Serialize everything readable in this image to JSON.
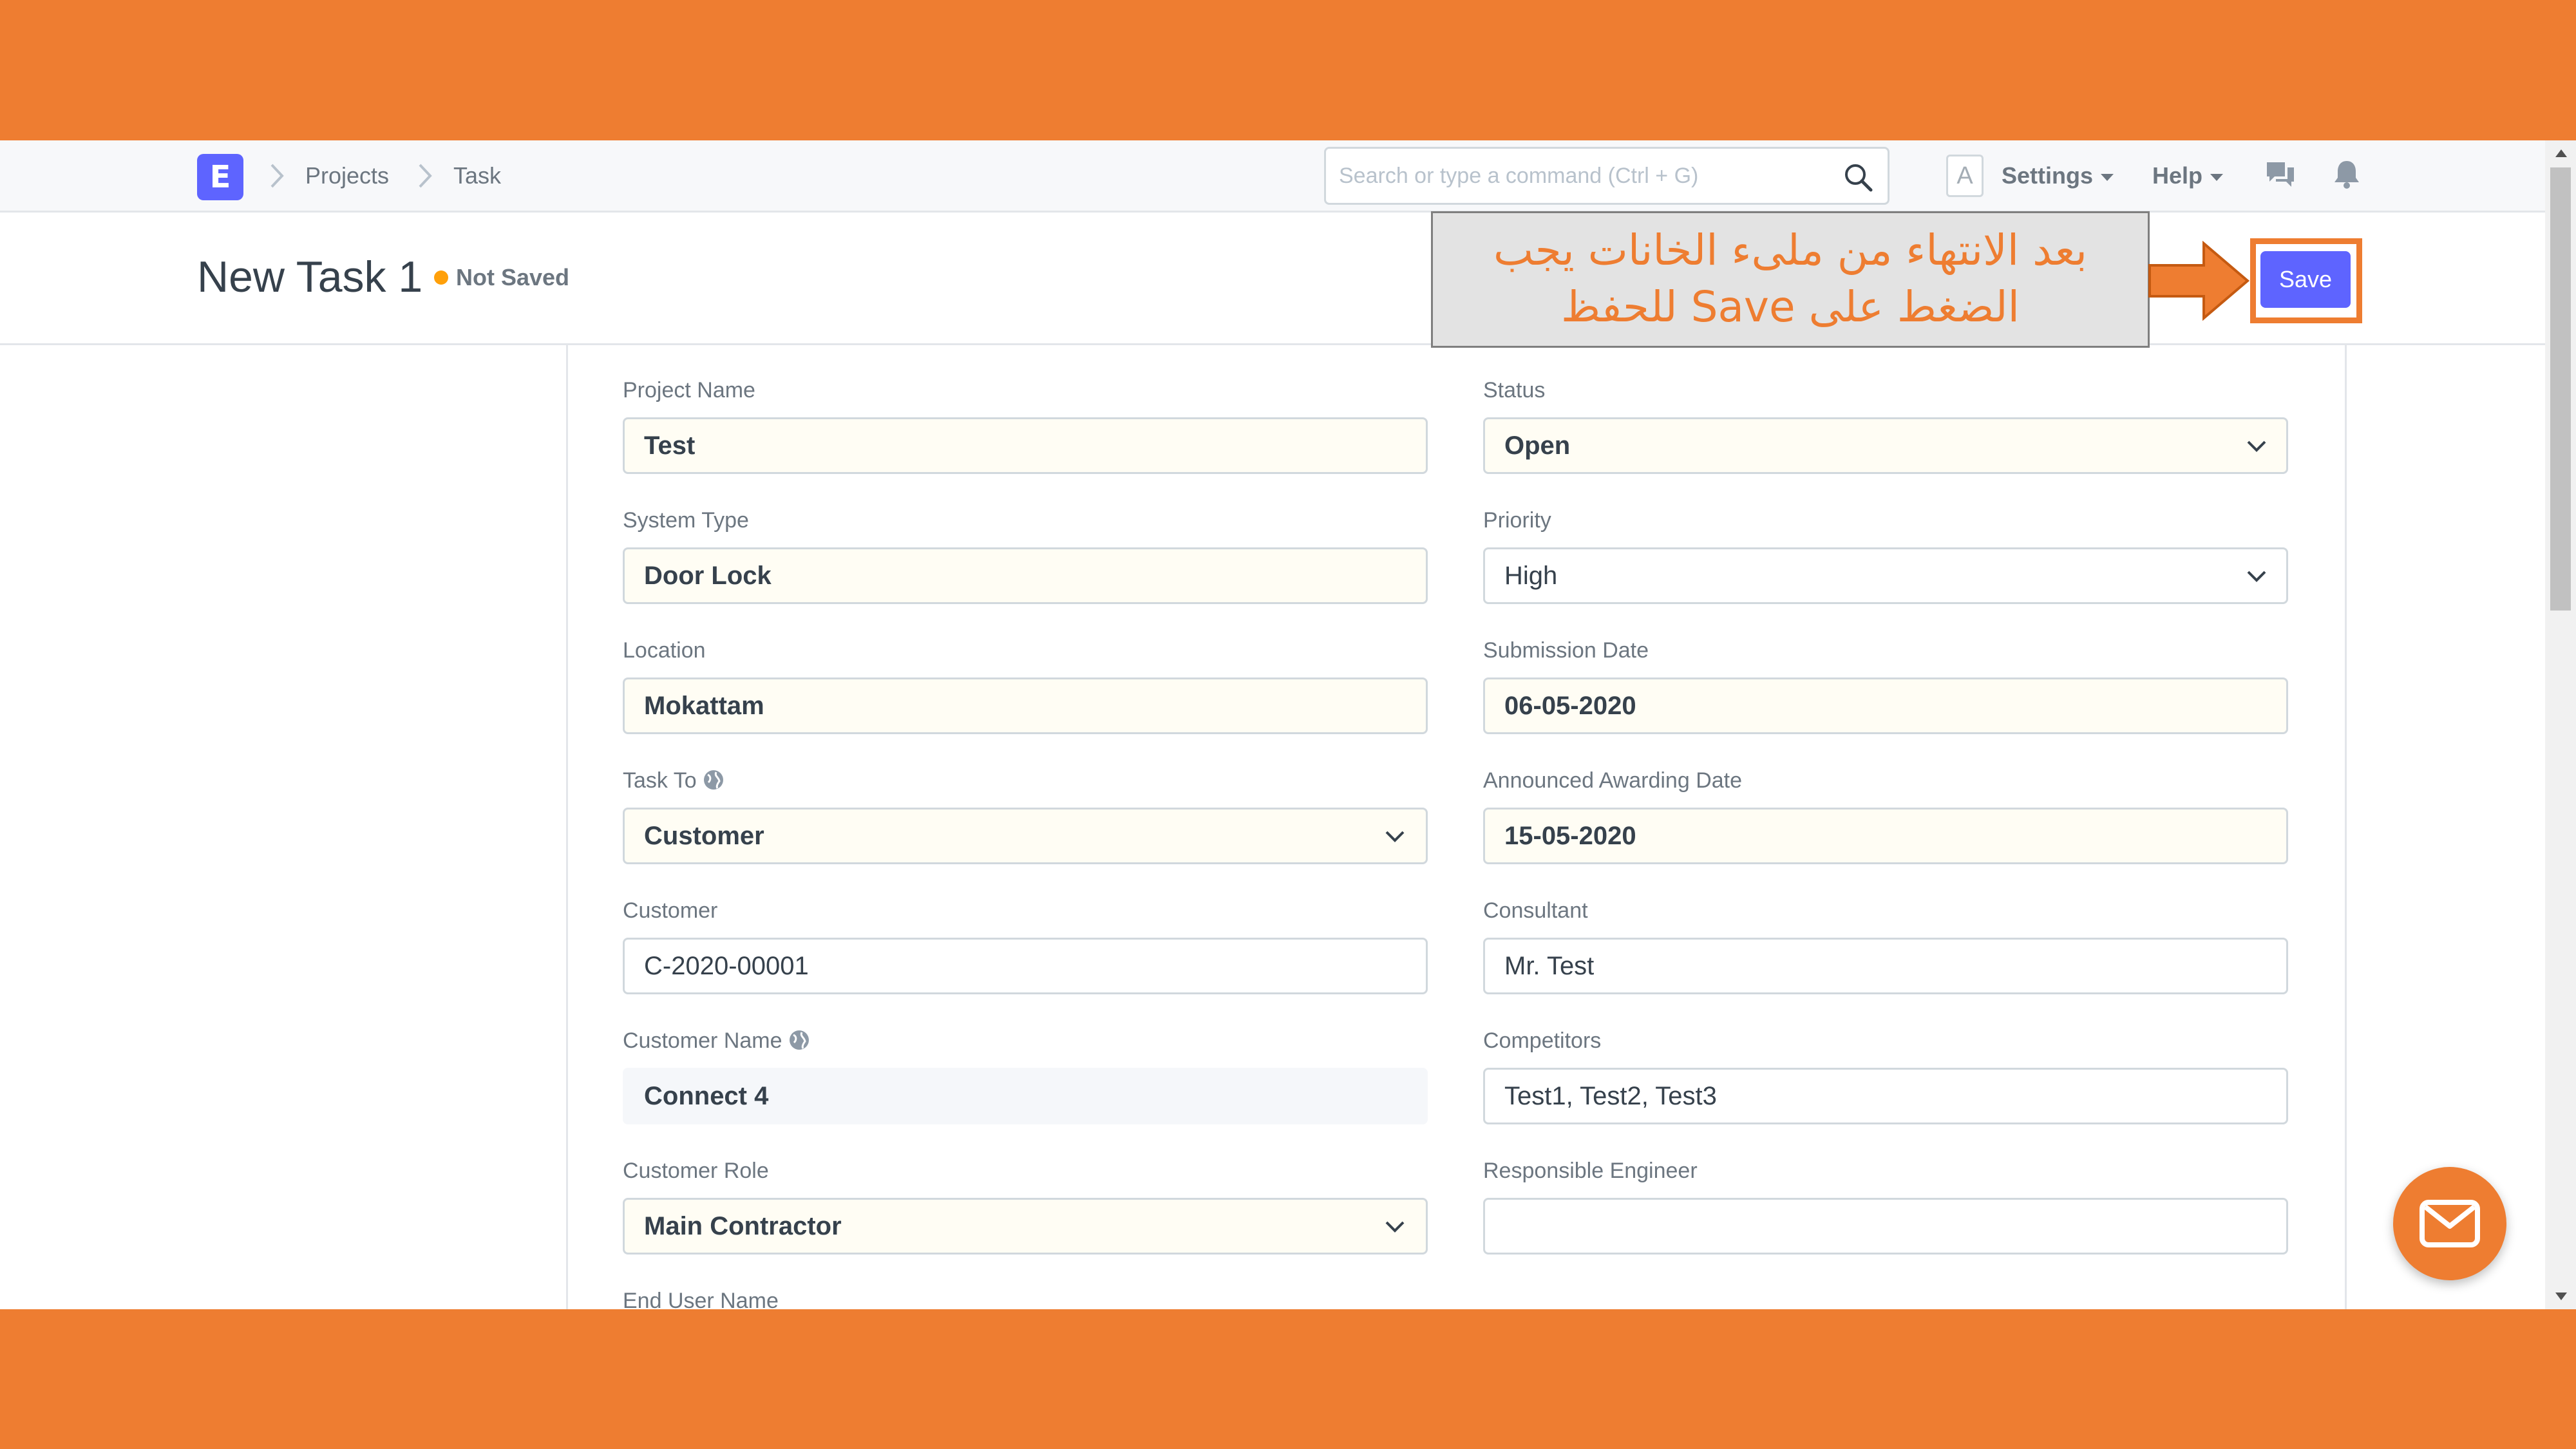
{
  "colors": {
    "frame": "#ee7d31",
    "primary": "#5e64ff",
    "not_saved_dot": "#ffa00a",
    "required_bg": "#fffdf4"
  },
  "navbar": {
    "logo_letter": "E",
    "breadcrumbs": [
      "Projects",
      "Task"
    ],
    "search_placeholder": "Search or type a command (Ctrl + G)",
    "avatar_letter": "A",
    "settings_label": "Settings",
    "help_label": "Help",
    "icons": [
      "search-icon",
      "chat-icon",
      "bell-icon"
    ]
  },
  "page": {
    "title": "New Task 1",
    "status": "Not Saved",
    "save_label": "Save"
  },
  "callout": {
    "line1": "بعد الانتهاء من ملىء الخانات يجب",
    "line2": "الضغط على Save للحفظ"
  },
  "form": {
    "project_name": {
      "label": "Project Name",
      "value": "Test"
    },
    "status": {
      "label": "Status",
      "value": "Open"
    },
    "system_type": {
      "label": "System Type",
      "value": "Door Lock"
    },
    "priority": {
      "label": "Priority",
      "value": "High"
    },
    "location": {
      "label": "Location",
      "value": "Mokattam"
    },
    "submission_date": {
      "label": "Submission Date",
      "value": "06-05-2020"
    },
    "task_to": {
      "label": "Task To",
      "value": "Customer"
    },
    "announced_awarding_date": {
      "label": "Announced Awarding Date",
      "value": "15-05-2020"
    },
    "customer": {
      "label": "Customer",
      "value": "C-2020-00001"
    },
    "consultant": {
      "label": "Consultant",
      "value": "Mr. Test"
    },
    "customer_name": {
      "label": "Customer Name",
      "value": "Connect 4"
    },
    "competitors": {
      "label": "Competitors",
      "value": "Test1, Test2, Test3"
    },
    "customer_role": {
      "label": "Customer Role",
      "value": "Main Contractor"
    },
    "responsible_engineer": {
      "label": "Responsible Engineer",
      "value": ""
    },
    "end_user_name": {
      "label": "End User Name"
    }
  }
}
